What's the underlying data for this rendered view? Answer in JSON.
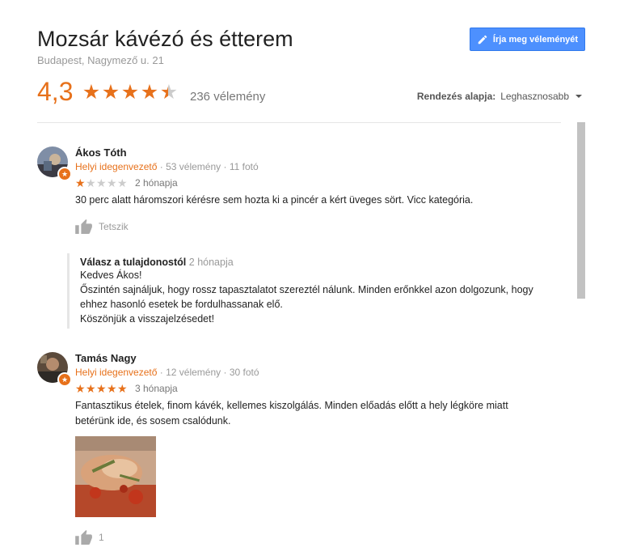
{
  "header": {
    "title": "Mozsár kávézó és étterem",
    "address": "Budapest, Nagymező u. 21",
    "write_review_label": "Írja meg véleményét",
    "pencil_icon": "pencil-icon"
  },
  "summary": {
    "rating": "4,3",
    "rating_value": 4.3,
    "review_count": "236 vélemény",
    "sort_label": "Rendezés alapja:",
    "sort_value": "Leghasznosabb"
  },
  "colors": {
    "accent": "#e7711b",
    "button": "#4d90fe",
    "star_empty": "#ccc"
  },
  "reviews": [
    {
      "name": "Ákos Tóth",
      "guide": "Helyi idegenvezető",
      "sep": "·",
      "reviews_count": "53 vélemény",
      "photos_count": "11 fotó",
      "stars": 1,
      "time": "2 hónapja",
      "text": "30 perc alatt háromszori kérésre sem hozta ki a pincér a kért üveges sört. Vicc kategória.",
      "like_label": "Tetszik",
      "owner_reply": {
        "heading": "Válasz a tulajdonostól",
        "time": "2 hónapja",
        "lines": [
          "Kedves Ákos!",
          "Őszintén sajnáljuk, hogy rossz tapasztalatot szereztél nálunk. Minden erőnkkel azon dolgozunk, hogy",
          "ehhez hasonló esetek be fordulhassanak elő.",
          "Köszönjük a visszajelzésedet!"
        ]
      }
    },
    {
      "name": "Tamás Nagy",
      "guide": "Helyi idegenvezető",
      "sep": "·",
      "reviews_count": "12 vélemény",
      "photos_count": "30 fotó",
      "stars": 5,
      "time": "3 hónapja",
      "text_lines": [
        "Fantasztikus ételek, finom kávék, kellemes kiszolgálás. Minden előadás előtt a hely légköre miatt",
        "betérünk ide, és sosem csalódunk."
      ],
      "like_count": "1"
    }
  ]
}
